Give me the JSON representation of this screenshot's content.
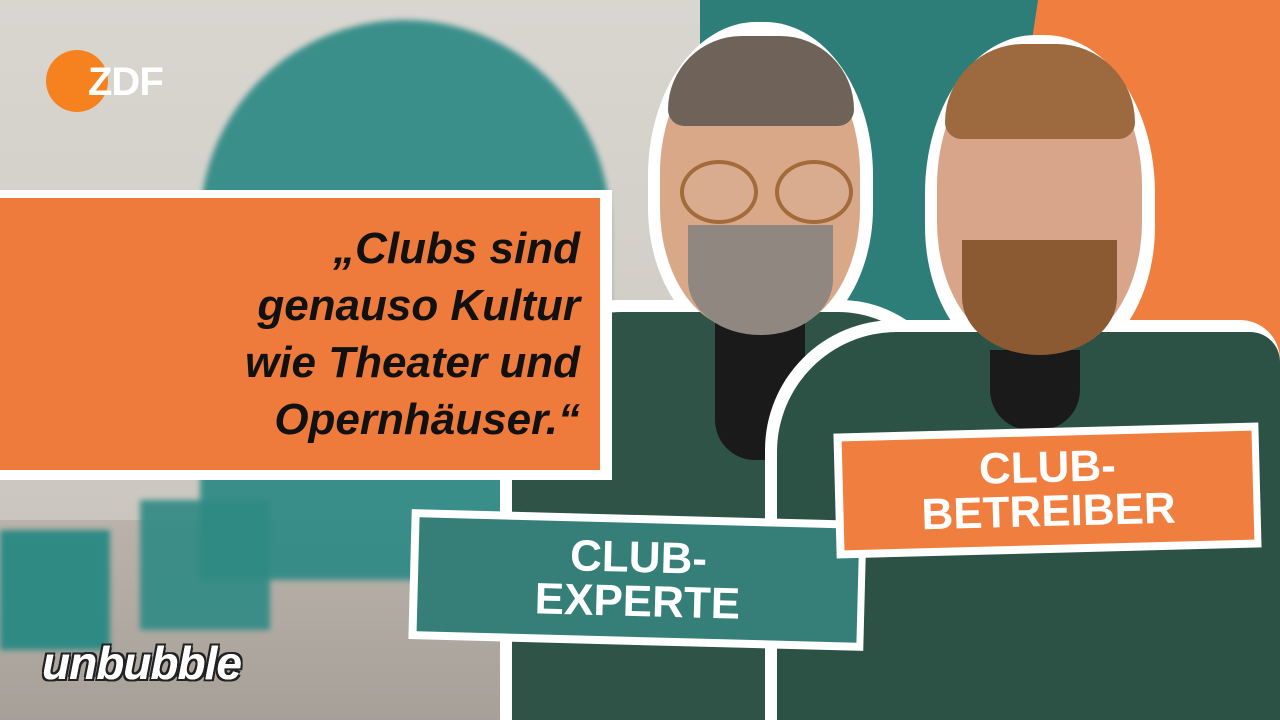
{
  "logos": {
    "broadcaster": "ZDF",
    "show": "unbubble"
  },
  "quote": {
    "text": "„Clubs sind genauso Kultur wie Theater und Opernhäuser.“",
    "lines": [
      "„Clubs sind",
      "genauso Kultur",
      "wie Theater und",
      "Opernhäuser.“"
    ]
  },
  "labels": {
    "left_person": {
      "line1": "CLUB-",
      "line2": "EXPERTE"
    },
    "right_person": {
      "line1": "CLUB-",
      "line2": "BETREIBER"
    }
  },
  "colors": {
    "orange": "#ee7a3b",
    "teal": "#367f79",
    "zdf_orange": "#f5821f",
    "jacket": "#2f5447"
  }
}
